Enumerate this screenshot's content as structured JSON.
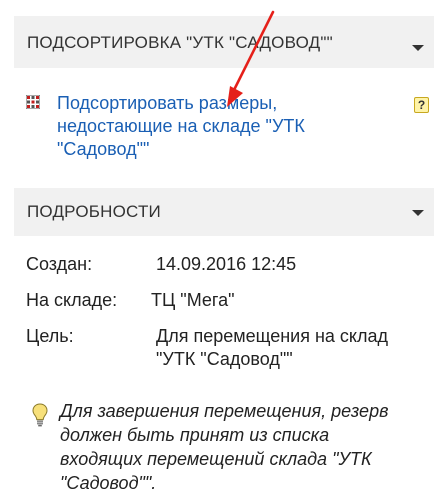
{
  "sections": {
    "restock": {
      "title": "ПОДСОРТИРОВКА \"УТК \"САДОВОД\"\"",
      "action_link": "Подсортировать размеры, недостающие на складе \"УТК \"Садовод\"\"",
      "help_label": "?"
    },
    "details": {
      "title": "ПОДРОБНОСТИ",
      "rows": [
        {
          "label": "Создан:",
          "value": "14.09.2016 12:45"
        },
        {
          "label": "На складе:",
          "value": "ТЦ \"Мега\""
        },
        {
          "label": "Цель:",
          "value": "Для перемещения на склад \"УТК \"Садовод\"\""
        }
      ],
      "hint": "Для завершения перемещения, резерв должен быть принят из списка входящих перемещений склада \"УТК \"Садовод\"\"."
    }
  },
  "icons": {
    "grid": "grid-icon",
    "help": "help-icon",
    "bulb": "lightbulb-icon",
    "chevron": "chevron-down-icon",
    "arrow": "arrow-annotation"
  },
  "colors": {
    "header_bg": "#f1f1f1",
    "link": "#1a5fb4",
    "arrow": "#e5201a"
  }
}
